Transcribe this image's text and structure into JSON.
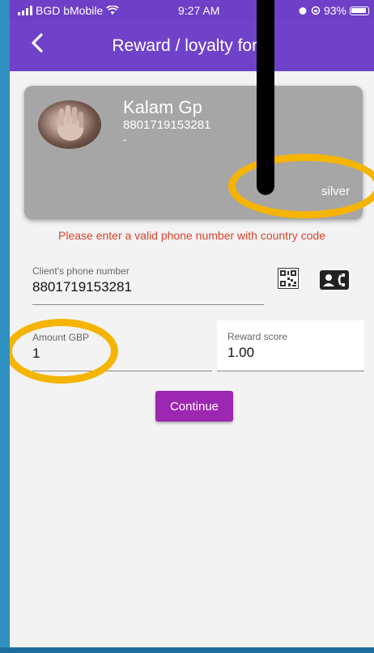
{
  "status_bar": {
    "carrier": "BGD bMobile",
    "time": "9:27 AM",
    "battery": "93%"
  },
  "app_bar": {
    "title": "Reward / loyalty form"
  },
  "client_card": {
    "name": "Kalam Gp",
    "phone": "8801719153281",
    "extra": "-",
    "tier": "silver"
  },
  "error_message": "Please enter a valid phone number with country code",
  "phone_field": {
    "label": "Client's phone number",
    "value": "8801719153281"
  },
  "amount_field": {
    "label": "Amount GBP",
    "value": "1"
  },
  "reward_field": {
    "label": "Reward score",
    "value": "1.00"
  },
  "continue_label": "Continue",
  "colors": {
    "app_bar": "#7042c9",
    "highlight_ring": "#f5b400",
    "error_text": "#d9432f",
    "continue_button": "#9c27b0"
  }
}
